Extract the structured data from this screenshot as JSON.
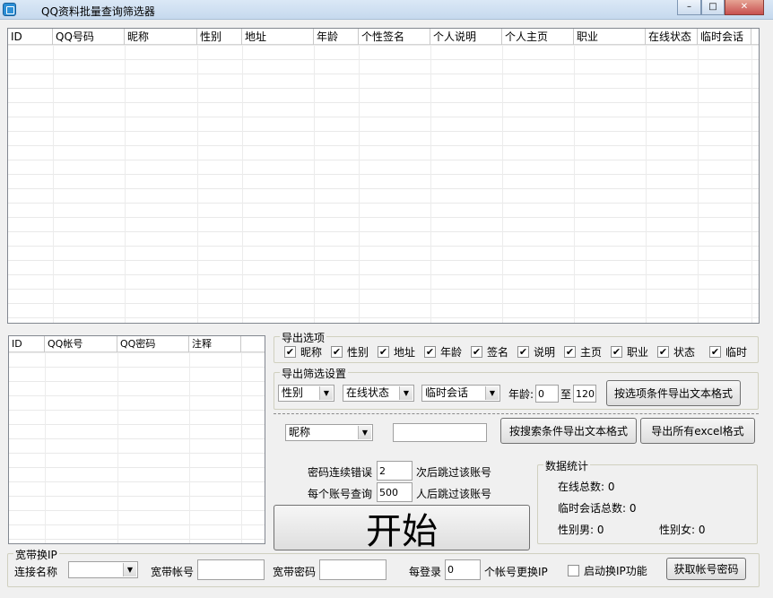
{
  "window": {
    "title": "QQ资料批量查询筛选器",
    "controls": {
      "minimize": "–",
      "maximize": "□",
      "close": "✕"
    }
  },
  "result_grid": {
    "columns": [
      "ID",
      "QQ号码",
      "昵称",
      "性别",
      "地址",
      "年龄",
      "个性签名",
      "个人说明",
      "个人主页",
      "职业",
      "在线状态",
      "临时会话"
    ]
  },
  "account_grid": {
    "columns": [
      "ID",
      "QQ帐号",
      "QQ密码",
      "注释"
    ]
  },
  "export_options": {
    "title": "导出选项",
    "items": [
      {
        "label": "昵称",
        "checked": true
      },
      {
        "label": "性别",
        "checked": true
      },
      {
        "label": "地址",
        "checked": true
      },
      {
        "label": "年龄",
        "checked": true
      },
      {
        "label": "签名",
        "checked": true
      },
      {
        "label": "说明",
        "checked": true
      },
      {
        "label": "主页",
        "checked": true
      },
      {
        "label": "职业",
        "checked": true
      },
      {
        "label": "状态",
        "checked": true
      },
      {
        "label": "临时",
        "checked": true
      }
    ]
  },
  "export_filter": {
    "title": "导出筛选设置",
    "gender_select": "性别",
    "status_select": "在线状态",
    "temp_chat_select": "临时会话",
    "age_label": "年龄:",
    "age_min": "0",
    "age_to": "至",
    "age_max": "120",
    "export_by_option_button": "按选项条件导出文本格式",
    "nickname_select": "昵称",
    "search_value": "",
    "export_by_search_button": "按搜索条件导出文本格式",
    "export_all_excel_button": "导出所有excel格式"
  },
  "query_settings": {
    "pwd_error_label": "密码连续错误",
    "pwd_error_value": "2",
    "pwd_error_suffix": "次后跳过该账号",
    "per_account_label": "每个账号查询",
    "per_account_value": "500",
    "per_account_suffix": "人后跳过该账号"
  },
  "start_button": "开始",
  "stats": {
    "title": "数据统计",
    "online_total": "在线总数: 0",
    "temp_chat_total": "临时会话总数: 0",
    "male": "性别男: 0",
    "female": "性别女: 0"
  },
  "broadband": {
    "title": "宽带换IP",
    "conn_name_label": "连接名称",
    "conn_name_value": "",
    "account_label": "宽带帐号",
    "account_value": "",
    "password_label": "宽带密码",
    "password_value": "",
    "every_login_label": "每登录",
    "every_login_value": "0",
    "change_ip_suffix": "个帐号更换IP",
    "enable_label": "启动换IP功能",
    "enable_checked": false,
    "get_account_button": "获取帐号密码"
  }
}
